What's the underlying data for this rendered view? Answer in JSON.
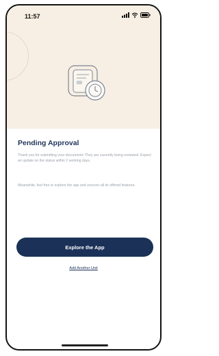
{
  "status_bar": {
    "time": "11:57",
    "icons": [
      "signal-icon",
      "wifi-icon",
      "battery-icon"
    ]
  },
  "illustration": {
    "icon": "document-clock-icon"
  },
  "main": {
    "title": "Pending Approval",
    "paragraph_1": "Thank you for submitting your documents! They are currently being reviewed. Expect an update on the status within 2 working days.",
    "paragraph_2": "Meanwhile, feel free to explore the app and uncover all its offered features.",
    "primary_button": "Explore the App",
    "secondary_link": "Add Another Unit"
  },
  "colors": {
    "hero_background": "#f7efe3",
    "primary": "#1b3157",
    "title": "#1f3559",
    "body_text": "#9aa0aa"
  }
}
